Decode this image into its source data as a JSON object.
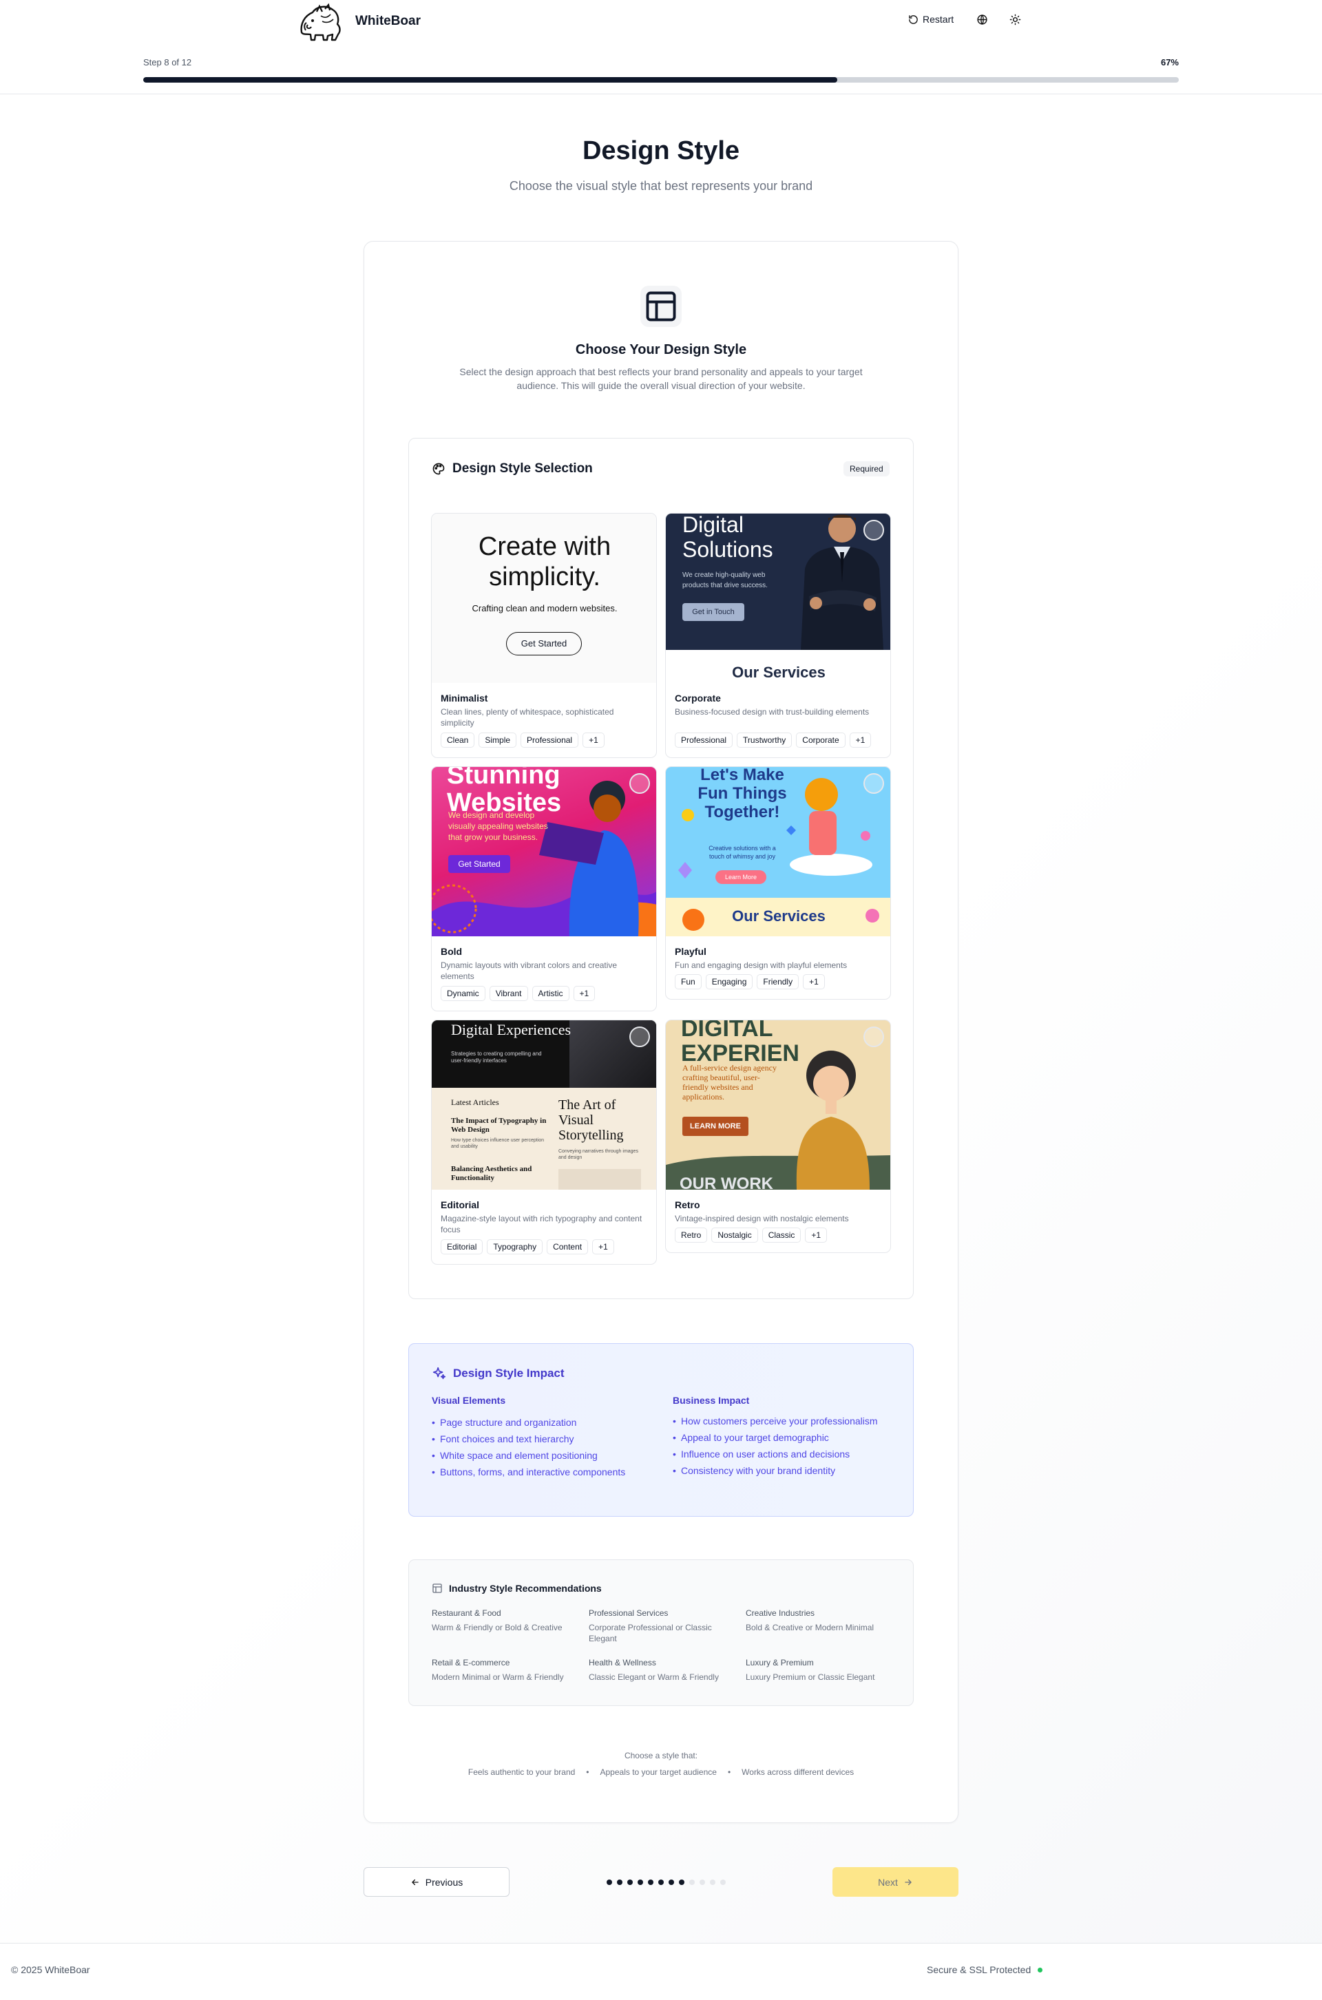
{
  "header": {
    "brand": "WhiteBoar",
    "restart": "Restart",
    "step": "Step 8 of 12",
    "progress_label": "67%",
    "progress": 0.67
  },
  "page": {
    "title": "Design Style",
    "subtitle": "Choose the visual style that best represents your brand"
  },
  "intro": {
    "title": "Choose Your Design Style",
    "description": "Select the design approach that best reflects your brand personality and appeals to your target audience. This will guide the overall visual direction of your website."
  },
  "selection": {
    "title": "Design Style Selection",
    "required": "Required",
    "options": [
      {
        "name": "Minimalist",
        "desc": "Clean lines, plenty of whitespace, sophisticated simplicity",
        "tags": [
          "Clean",
          "Simple",
          "Professional",
          "+1"
        ],
        "preview": {
          "headline": "Create with simplicity.",
          "sub": "Crafting clean and modern websites.",
          "cta": "Get Started"
        }
      },
      {
        "name": "Corporate",
        "desc": "Business-focused design with trust-building elements",
        "tags": [
          "Professional",
          "Trustworthy",
          "Corporate",
          "+1"
        ],
        "preview": {
          "headline": "Digital Solutions",
          "sub": "We create high-quality web products that drive success.",
          "cta": "Get in Touch",
          "footer": "Our Services"
        }
      },
      {
        "name": "Bold",
        "desc": "Dynamic layouts with vibrant colors and creative elements",
        "tags": [
          "Dynamic",
          "Vibrant",
          "Artistic",
          "+1"
        ],
        "preview": {
          "headline": "Stunning Websites",
          "sub": "We design and develop visually appealing websites that grow your business.",
          "cta": "Get Started"
        }
      },
      {
        "name": "Playful",
        "desc": "Fun and engaging design with playful elements",
        "tags": [
          "Fun",
          "Engaging",
          "Friendly",
          "+1"
        ],
        "preview": {
          "headline": "Let's Make Fun Things Together!",
          "sub": "Creative solutions with a touch of whimsy and joy",
          "cta": "Learn More",
          "footer": "Our Services"
        }
      },
      {
        "name": "Editorial",
        "desc": "Magazine-style layout with rich typography and content focus",
        "tags": [
          "Editorial",
          "Typography",
          "Content",
          "+1"
        ],
        "preview": {
          "headline": "Digital Experiences",
          "sub": "Strategies to creating compelling and user-friendly interfaces",
          "latest": "Latest Articles",
          "a1": "The Impact of Typography in Web Design",
          "a1s": "How type choices influence user perception and usability",
          "a2": "Balancing Aesthetics and Functionality",
          "feature": "The Art of Visual Storytelling",
          "features": "Conveying narratives through images and design"
        }
      },
      {
        "name": "Retro",
        "desc": "Vintage-inspired design with nostalgic elements",
        "tags": [
          "Retro",
          "Nostalgic",
          "Classic",
          "+1"
        ],
        "preview": {
          "headline": "DIGITAL EXPERIEN",
          "sub": "A full-service design agency crafting beautiful, user-friendly websites and applications.",
          "cta": "LEARN MORE",
          "footer": "OUR WORK"
        }
      }
    ]
  },
  "impact": {
    "title": "Design Style Impact",
    "visual": {
      "heading": "Visual Elements",
      "items": [
        "Page structure and organization",
        "Font choices and text hierarchy",
        "White space and element positioning",
        "Buttons, forms, and interactive components"
      ]
    },
    "business": {
      "heading": "Business Impact",
      "items": [
        "How customers perceive your professionalism",
        "Appeal to your target demographic",
        "Influence on user actions and decisions",
        "Consistency with your brand identity"
      ]
    }
  },
  "recommendations": {
    "title": "Industry Style Recommendations",
    "items": [
      {
        "industry": "Restaurant & Food",
        "styles": "Warm & Friendly or Bold & Creative"
      },
      {
        "industry": "Professional Services",
        "styles": "Corporate Professional or Classic Elegant"
      },
      {
        "industry": "Creative Industries",
        "styles": "Bold & Creative or Modern Minimal"
      },
      {
        "industry": "Retail & E-commerce",
        "styles": "Modern Minimal or Warm & Friendly"
      },
      {
        "industry": "Health & Wellness",
        "styles": "Classic Elegant or Warm & Friendly"
      },
      {
        "industry": "Luxury & Premium",
        "styles": "Luxury Premium or Classic Elegant"
      }
    ]
  },
  "tips": {
    "heading": "Choose a style that:",
    "items": [
      "Feels authentic to your brand",
      "Appeals to your target audience",
      "Works across different devices"
    ]
  },
  "nav": {
    "previous": "Previous",
    "next": "Next",
    "steps_total": 12,
    "current_step": 8
  },
  "footer": {
    "copyright": "© 2025 WhiteBoar",
    "secure": "Secure & SSL Protected"
  },
  "colors": {
    "primary": "#0f172a",
    "accent_yellow": "#fde68a",
    "indigo": "#4338ca",
    "success": "#22c55e"
  }
}
